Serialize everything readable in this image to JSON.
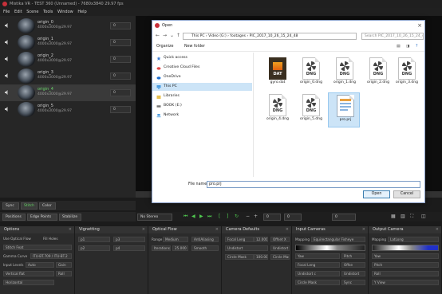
{
  "window": {
    "title": "Mistika VR - TEST 360 (Unnamed) - 7680x3840 29.97 fps"
  },
  "menu": [
    "File",
    "Edit",
    "Scene",
    "Tools",
    "Window",
    "Help"
  ],
  "sources": [
    {
      "name": "origin_0",
      "format": "4000x3000@29.97",
      "value": "0"
    },
    {
      "name": "origin_1",
      "format": "4000x3000@29.97",
      "value": "0"
    },
    {
      "name": "origin_2",
      "format": "4000x3000@29.97",
      "value": "0"
    },
    {
      "name": "origin_3",
      "format": "4000x3000@29.97",
      "value": "0"
    },
    {
      "name": "origin_4",
      "format": "4000x3000@29.97",
      "value": "0"
    },
    {
      "name": "origin_5",
      "format": "4000x3000@29.97",
      "value": "0"
    }
  ],
  "toolbar": {
    "sync": "Sync",
    "stitch": "Stitch",
    "color": "Color",
    "positions": "Positions",
    "edge_points": "Edge Points",
    "stabilize": "Stabilize",
    "no_stereo": "No Stereo",
    "frame": "0",
    "zero_a": "0",
    "zero_b": "0"
  },
  "panels": {
    "options": {
      "title": "Options",
      "use_optical_flow": "Use Optical Flow",
      "fill_holes": "Fill Holes",
      "stitch_feather": "Stitch Feat",
      "gamma_curve_label": "Gamma Curve",
      "gamma_curve": "ITU-BT.709 / ITU-BT.2",
      "input_levels_label": "Input Levels",
      "input_levels": "Auto",
      "vertical": "Vertical flat",
      "horizontal": "Horizontal",
      "gain": "Gain",
      "roll": "Roll"
    },
    "vignetting": {
      "title": "Vignetting",
      "p1": "p1",
      "p2": "p2",
      "p3": "p3",
      "p4": "p4"
    },
    "optical_flow": {
      "title": "Optical Flow",
      "range_label": "Range",
      "range": "Medium",
      "iterations": "Iterations",
      "iter_value": "25.000",
      "anti_aliasing": "AntiAliasing",
      "smooth": "Smooth"
    },
    "camera_defaults": {
      "title": "Camera Defaults",
      "focal_length": "Focal Leng",
      "focal_value": "12.000",
      "distortion": "Undistort",
      "circle_mask": "Circle Mask",
      "circle_value": "100.000",
      "offset": "Offset X",
      "undist2": "Undistort",
      "circle2": "Circle Mask"
    },
    "input_cameras": {
      "title": "Input Cameras",
      "mapping_label": "Mapping",
      "mapping": "Equirectangular Fisheye",
      "yaw": "Yaw",
      "focal": "Focal Leng",
      "undistort": "Undistort c",
      "circle": "Circle Mask",
      "pitch": "Pitch",
      "offset": "Offse",
      "undist2": "Undistort",
      "sync": "Sync"
    },
    "output_camera": {
      "title": "Output Camera",
      "mapping_label": "Mapping",
      "mapping": "LatLong",
      "yaw": "Yaw",
      "pitch": "Pitch",
      "roll": "Roll",
      "edge_points": "Edge Points",
      "y_view": "Y View"
    }
  },
  "dialog": {
    "title": "Open",
    "path": [
      "This PC",
      "Video (G:)",
      "footages",
      "PIC_2017_10_26_15_24_48"
    ],
    "search_placeholder": "Search PIC_2017_10_26_15_24_48",
    "organize": "Organize",
    "new_folder": "New folder",
    "nav": [
      {
        "label": "Quick access",
        "icon": "star-icon"
      },
      {
        "label": "Creative Cloud Files",
        "icon": "cloud-icon"
      },
      {
        "label": "OneDrive",
        "icon": "cloud-icon"
      },
      {
        "label": "This PC",
        "icon": "computer-icon"
      },
      {
        "label": "Libraries",
        "icon": "library-icon"
      },
      {
        "label": "BOOK (E:)",
        "icon": "drive-icon"
      },
      {
        "label": "Network",
        "icon": "network-icon"
      }
    ],
    "files": [
      {
        "name": "gyro.dat",
        "type": "DAT"
      },
      {
        "name": "origin_0.dng",
        "type": "DNG"
      },
      {
        "name": "origin_1.dng",
        "type": "DNG"
      },
      {
        "name": "origin_2.dng",
        "type": "DNG"
      },
      {
        "name": "origin_3.dng",
        "type": "DNG"
      },
      {
        "name": "origin_4.dng",
        "type": "DNG"
      },
      {
        "name": "origin_5.dng",
        "type": "DNG"
      },
      {
        "name": "pro.prj",
        "type": "PRJ"
      }
    ],
    "file_name_label": "File name:",
    "file_name": "pro.prj",
    "open": "Open",
    "cancel": "Cancel"
  }
}
